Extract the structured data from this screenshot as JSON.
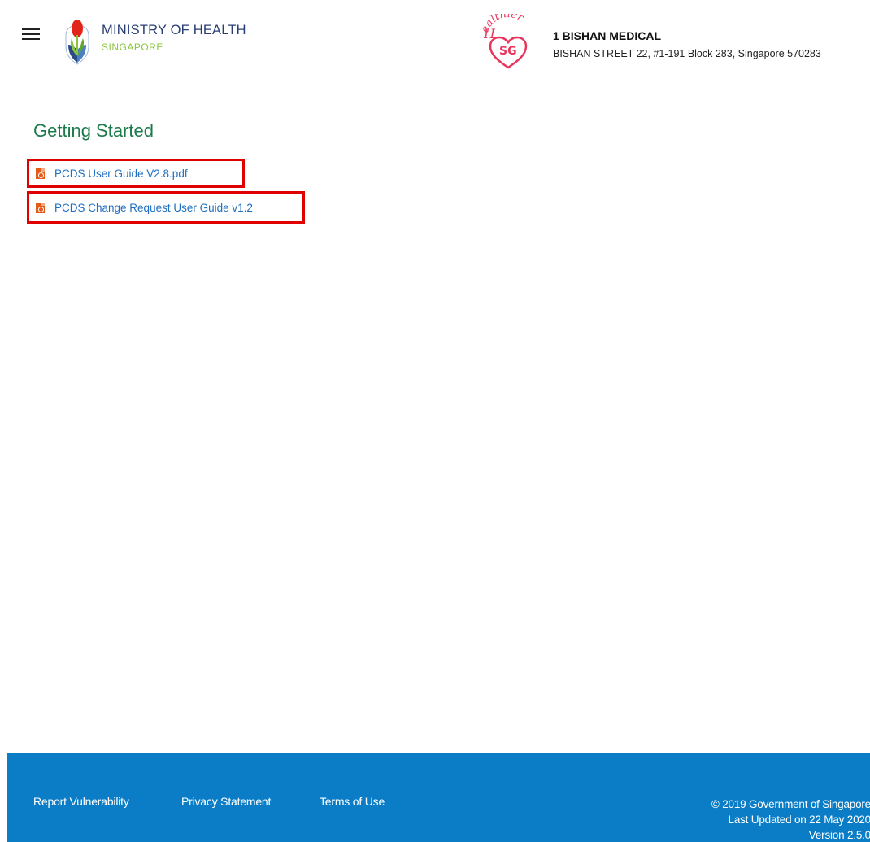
{
  "header": {
    "menu_icon": "hamburger-menu-icon",
    "ministry_title": "MINISTRY OF HEALTH",
    "ministry_subtitle": "SINGAPORE",
    "healthier_sg_logo_text": "Healthier SG",
    "clinic_name": "1 BISHAN MEDICAL",
    "clinic_address": "BISHAN STREET 22, #1-191 Block 283, Singapore 570283"
  },
  "main": {
    "title": "Getting Started",
    "guides": [
      {
        "label": "PCDS User Guide V2.8.pdf",
        "icon": "pdf-file-icon"
      },
      {
        "label": "PCDS Change Request User Guide v1.2",
        "icon": "pdf-file-icon"
      }
    ]
  },
  "footer": {
    "links": [
      "Report Vulnerability",
      "Privacy Statement",
      "Terms of Use"
    ],
    "copyright": "© 2019 Government of Singapore",
    "last_updated": "Last Updated on 22 May 2020",
    "version": "Version 2.5.0"
  },
  "colors": {
    "footer_bg": "#0a7dc6",
    "title_green": "#1d7a4a",
    "link_blue": "#1f6fbf",
    "highlight_red": "#e10000",
    "moh_blue": "#2a3e76",
    "moh_green": "#8cc43f",
    "hsg_pink": "#e8365d"
  }
}
